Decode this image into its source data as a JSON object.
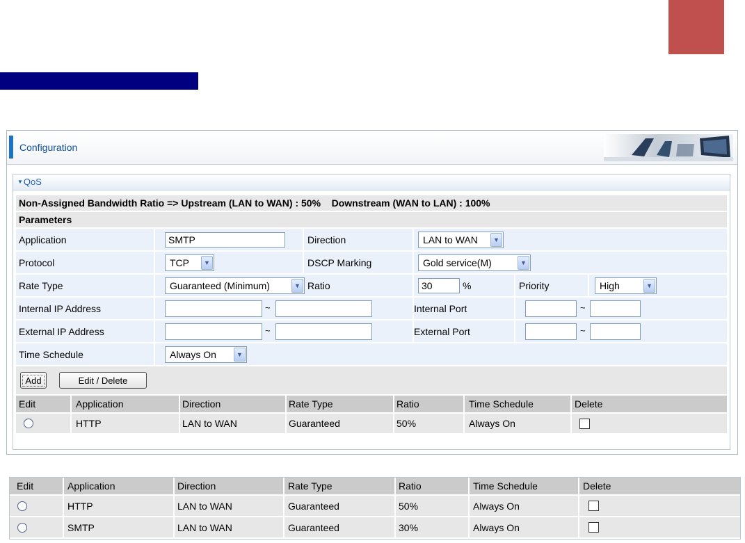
{
  "colors": {
    "accent_red": "#c0504d",
    "navy": "#000080",
    "header_text": "#0d4f9c",
    "accent_blue": "#1e73c8"
  },
  "panel": {
    "title": "Configuration"
  },
  "qos": {
    "section_title": "QoS",
    "bandwidth_info": "Non-Assigned Bandwidth Ratio => Upstream (LAN to WAN) : 50%    Downstream (WAN to LAN) : 100%",
    "parameters_label": "Parameters",
    "form": {
      "application_label": "Application",
      "application_value": "SMTP",
      "direction_label": "Direction",
      "direction_value": "LAN to WAN",
      "protocol_label": "Protocol",
      "protocol_value": "TCP",
      "dscp_label": "DSCP Marking",
      "dscp_value": "Gold service(M)",
      "rate_type_label": "Rate Type",
      "rate_type_value": "Guaranteed (Minimum)",
      "ratio_label": "Ratio",
      "ratio_value": "30",
      "ratio_unit": "%",
      "priority_label": "Priority",
      "priority_value": "High",
      "internal_ip_label": "Internal IP Address",
      "internal_port_label": "Internal Port",
      "external_ip_label": "External IP Address",
      "external_port_label": "External Port",
      "range_separator": "~",
      "time_schedule_label": "Time Schedule",
      "time_schedule_value": "Always On"
    },
    "buttons": {
      "add": "Add",
      "edit_delete": "Edit / Delete"
    },
    "table": {
      "headers": [
        "Edit",
        "Application",
        "Direction",
        "Rate Type",
        "Ratio",
        "Time Schedule",
        "Delete"
      ],
      "rows": [
        {
          "application": "HTTP",
          "direction": "LAN to WAN",
          "rate_type": "Guaranteed",
          "ratio": "50%",
          "time_schedule": "Always On"
        }
      ]
    }
  },
  "bottom_table": {
    "headers": [
      "Edit",
      "Application",
      "Direction",
      "Rate Type",
      "Ratio",
      "Time Schedule",
      "Delete"
    ],
    "rows": [
      {
        "application": "HTTP",
        "direction": "LAN to WAN",
        "rate_type": "Guaranteed",
        "ratio": "50%",
        "time_schedule": "Always On"
      },
      {
        "application": "SMTP",
        "direction": "LAN to WAN",
        "rate_type": "Guaranteed",
        "ratio": "30%",
        "time_schedule": "Always On"
      }
    ]
  }
}
